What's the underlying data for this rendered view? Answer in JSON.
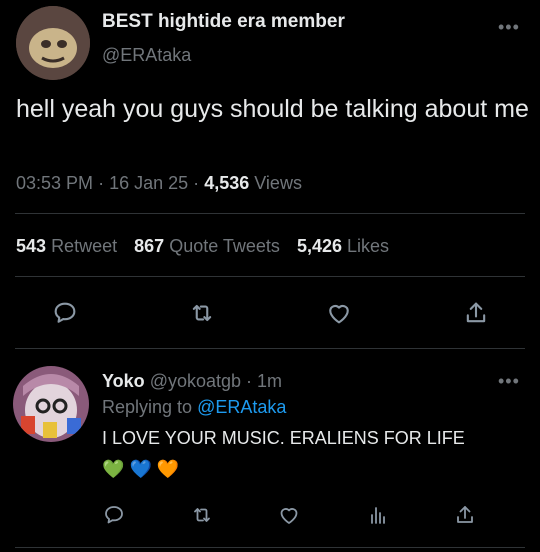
{
  "tweet": {
    "author_name": "BEST hightide era member",
    "handle": "@ERAtaka",
    "text": "hell yeah you guys should be talking about me",
    "time": "03:53 PM",
    "sep1": "·",
    "date": "16 Jan 25",
    "sep2": "·",
    "views_count": "4,536",
    "views_label": "Views",
    "more": "•••",
    "stats": {
      "retweets_count": "543",
      "retweets_label": "Retweet",
      "quotes_count": "867",
      "quotes_label": "Quote Tweets",
      "likes_count": "5,426",
      "likes_label": "Likes"
    },
    "actions": [
      "reply-icon",
      "retweet-icon",
      "like-icon",
      "share-icon"
    ]
  },
  "reply": {
    "author_name": "Yoko",
    "handle": "@yokoatgb",
    "sep": "·",
    "time": "1m",
    "replying_to_label": "Replying to",
    "replying_to_handle": "@ERAtaka",
    "text": "I LOVE YOUR MUSIC. ERALIENS FOR LIFE",
    "emojis": [
      "💚",
      "💙",
      "🧡"
    ],
    "more": "•••",
    "actions": [
      "reply-icon",
      "retweet-icon",
      "like-icon",
      "views-icon",
      "share-icon"
    ]
  },
  "colors": {
    "background": "#000000",
    "text": "#e7e9ea",
    "muted": "#71767b",
    "link": "#1d9bf0",
    "divider": "#2f3336"
  }
}
